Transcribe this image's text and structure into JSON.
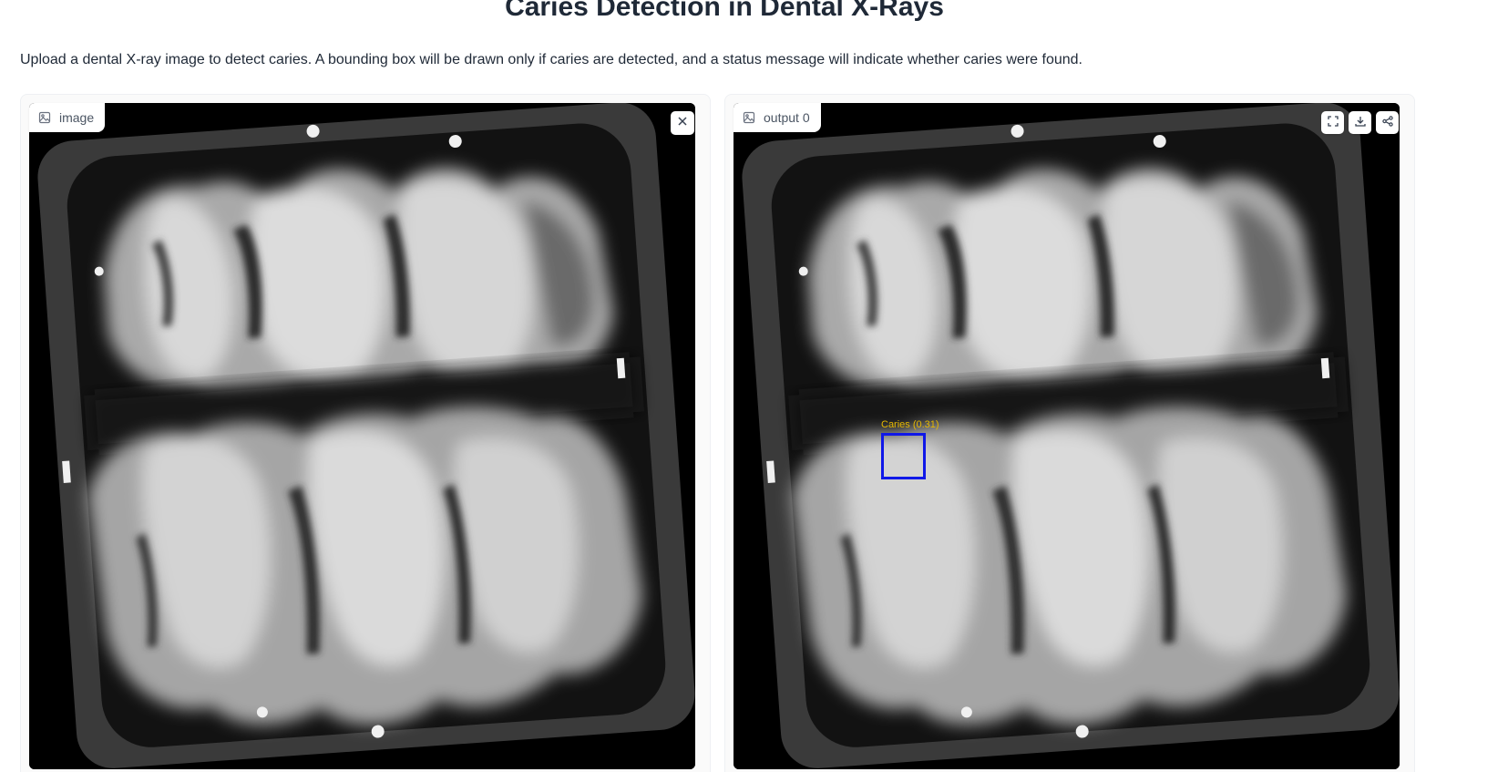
{
  "header": {
    "title": "Caries Detection in Dental X-Rays",
    "description": "Upload a dental X-ray image to detect caries. A bounding box will be drawn only if caries are detected, and a status message will indicate whether caries were found."
  },
  "input_panel": {
    "label": "image",
    "label_icon": "image-icon",
    "close_icon": "close-icon"
  },
  "output_panel": {
    "label": "output 0",
    "label_icon": "image-icon",
    "toolbar_icons": [
      "fullscreen-icon",
      "download-icon",
      "share-icon"
    ],
    "detection": {
      "label": "Caries (0.31)",
      "box_color": "#1018e8",
      "label_color": "#e6b800"
    }
  }
}
